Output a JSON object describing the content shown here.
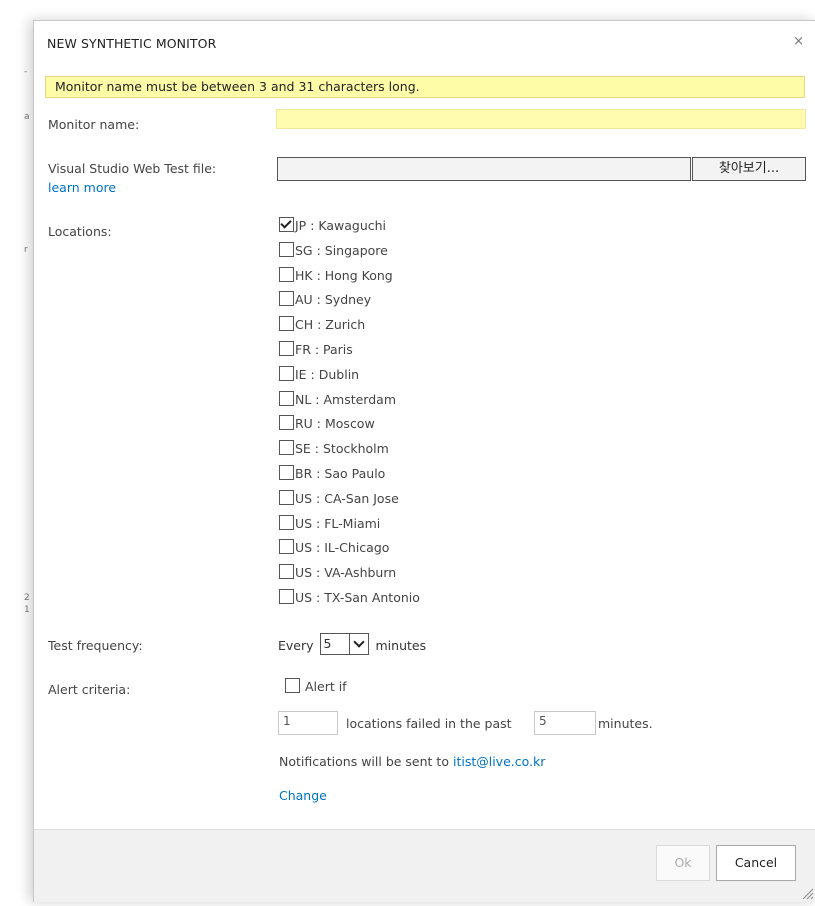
{
  "dialog": {
    "title": "NEW SYNTHETIC MONITOR",
    "close_glyph": "×"
  },
  "error_message": "Monitor name must be between 3 and 31 characters long.",
  "monitor_name": {
    "label": "Monitor name:",
    "value": ""
  },
  "web_test_file": {
    "label": "Visual Studio Web Test file:",
    "learn_more": "learn more",
    "value": "",
    "browse_label": "찾아보기..."
  },
  "locations": {
    "label": "Locations:",
    "items": [
      {
        "label": "JP : Kawaguchi",
        "checked": true
      },
      {
        "label": "SG : Singapore",
        "checked": false
      },
      {
        "label": "HK : Hong Kong",
        "checked": false
      },
      {
        "label": "AU : Sydney",
        "checked": false
      },
      {
        "label": "CH : Zurich",
        "checked": false
      },
      {
        "label": "FR : Paris",
        "checked": false
      },
      {
        "label": "IE : Dublin",
        "checked": false
      },
      {
        "label": "NL : Amsterdam",
        "checked": false
      },
      {
        "label": "RU : Moscow",
        "checked": false
      },
      {
        "label": "SE : Stockholm",
        "checked": false
      },
      {
        "label": "BR : Sao Paulo",
        "checked": false
      },
      {
        "label": "US : CA-San Jose",
        "checked": false
      },
      {
        "label": "US : FL-Miami",
        "checked": false
      },
      {
        "label": "US : IL-Chicago",
        "checked": false
      },
      {
        "label": "US : VA-Ashburn",
        "checked": false
      },
      {
        "label": "US : TX-San Antonio",
        "checked": false
      }
    ]
  },
  "test_frequency": {
    "label": "Test frequency:",
    "prefix": "Every",
    "selected": "5",
    "suffix": "minutes"
  },
  "alert_criteria": {
    "label": "Alert criteria:",
    "checkbox_label": "Alert if",
    "checked": false,
    "locations_failed_value": "1",
    "locations_failed_text": "locations failed in the past",
    "minutes_value": "5",
    "minutes_text": "minutes.",
    "notification_text": "Notifications will be sent to",
    "email": "itist@live.co.kr",
    "change_link": "Change"
  },
  "footer": {
    "ok_label": "Ok",
    "cancel_label": "Cancel"
  },
  "background_glyphs": [
    "-",
    "a",
    "r",
    "2",
    "1"
  ],
  "colors": {
    "link": "#0072c6",
    "error_bg": "#fffca8",
    "required_field_bg": "#fffcb0"
  }
}
